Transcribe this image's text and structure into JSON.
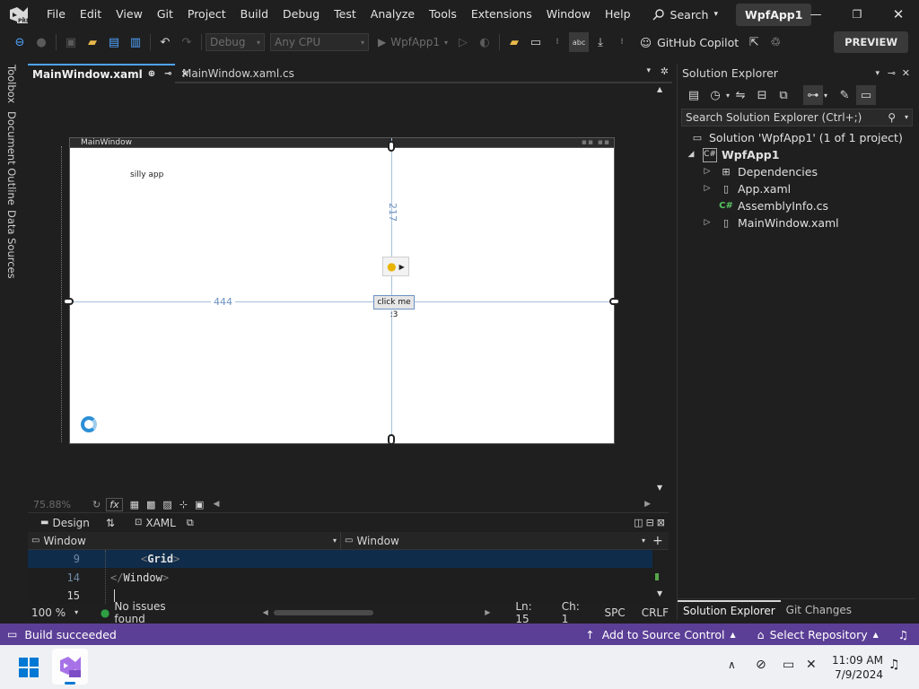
{
  "menubar": {
    "items": [
      "File",
      "Edit",
      "View",
      "Git",
      "Project",
      "Build",
      "Debug",
      "Test",
      "Analyze",
      "Tools",
      "Extensions",
      "Window",
      "Help"
    ],
    "search_label": "Search",
    "solution_name": "WpfApp1",
    "logo_badge": "PRE"
  },
  "toolbar": {
    "config": "Debug",
    "platform": "Any CPU",
    "start_target": "WpfApp1",
    "copilot_label": "GitHub Copilot",
    "preview_label": "PREVIEW"
  },
  "left_strip": {
    "tabs": [
      "Toolbox",
      "Document Outline",
      "Data Sources"
    ]
  },
  "doc_tabs": {
    "active": "MainWindow.xaml",
    "inactive": "MainWindow.xaml.cs"
  },
  "designer": {
    "window_title": "MainWindow",
    "label_text": "silly app",
    "button_text": "click me :3",
    "margin_top": "217",
    "margin_left": "444",
    "zoom": "75.88%"
  },
  "split_bar": {
    "design_label": "Design",
    "xaml_label": "XAML"
  },
  "view_bar": {
    "left_combo": "Window",
    "right_combo": "Window"
  },
  "code": {
    "lines": [
      {
        "num": "9",
        "open": "<",
        "tag": "Grid",
        "close": ">"
      },
      {
        "num": "14",
        "open": "</",
        "tag": "Window",
        "close": ">"
      },
      {
        "num": "15",
        "open": "",
        "tag": "",
        "close": ""
      }
    ]
  },
  "editor_status": {
    "zoom": "100 %",
    "issues": "No issues found",
    "line": "Ln: 15",
    "col": "Ch: 1",
    "spacing": "SPC",
    "eol": "CRLF"
  },
  "solution_explorer": {
    "title": "Solution Explorer",
    "search_placeholder": "Search Solution Explorer (Ctrl+;)",
    "solution": "Solution 'WpfApp1' (1 of 1 project)",
    "project": "WpfApp1",
    "items": [
      "Dependencies",
      "App.xaml",
      "AssemblyInfo.cs",
      "MainWindow.xaml"
    ],
    "bottom_tabs": [
      "Solution Explorer",
      "Git Changes"
    ]
  },
  "statusbar": {
    "build": "Build succeeded",
    "source_control": "Add to Source Control",
    "repository": "Select Repository"
  },
  "taskbar": {
    "time": "11:09 AM",
    "date": "7/9/2024"
  },
  "colors": {
    "accent": "#4fa3ff",
    "status_bar": "#5b3e96",
    "vs_purple": "#a772e8"
  }
}
